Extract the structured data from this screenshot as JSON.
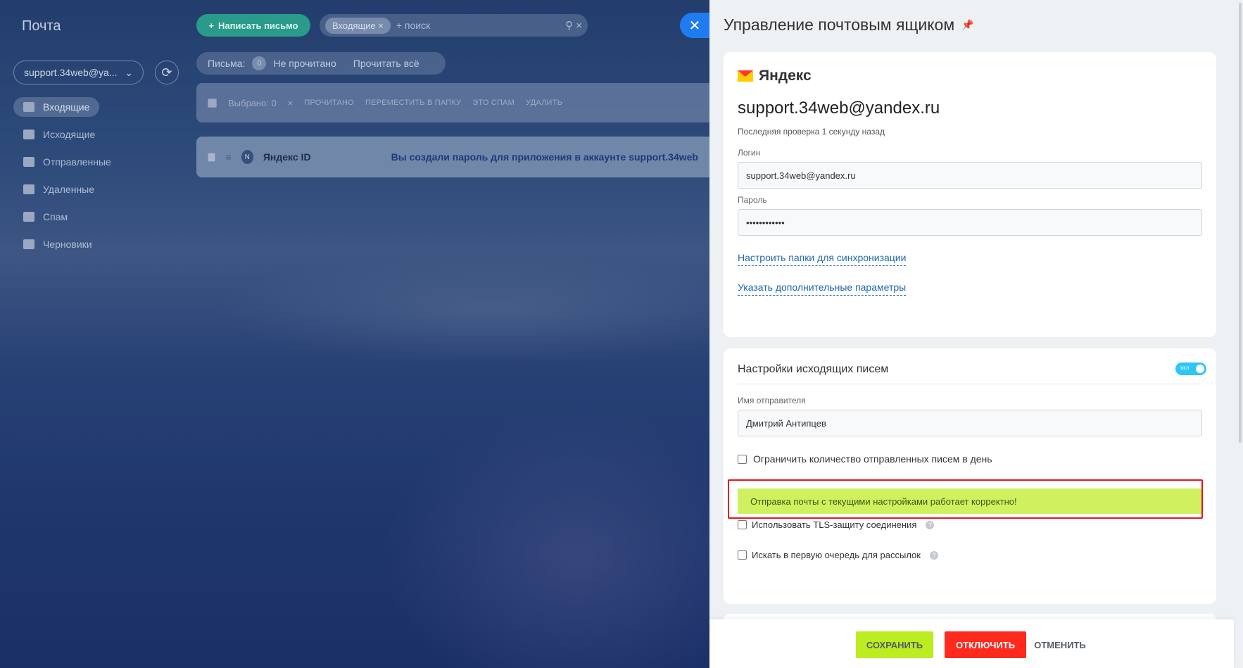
{
  "left": {
    "app_title": "Почта",
    "account": "support.34web@ya...",
    "nav": [
      "Входящие",
      "Исходящие",
      "Отправленные",
      "Удаленные",
      "Спам",
      "Черновики"
    ],
    "compose": "Написать письмо",
    "search_chip": "Входящие",
    "search_placeholder": "+ поиск",
    "filter_label": "Письма:",
    "filter_count": "0",
    "filter_unread": "Не прочитано",
    "filter_read_all": "Прочитать всё",
    "selected": "Выбрано: 0",
    "actions": [
      "ПРОЧИТАНО",
      "ПЕРЕМЕСТИТЬ В ПАПКУ",
      "ЭТО СПАМ",
      "УДАЛИТЬ"
    ],
    "mail": {
      "avatar": "N",
      "sender": "Яндекс ID",
      "subject": "Вы создали пароль для приложения в аккаунте support.34web"
    }
  },
  "panel": {
    "title": "Управление почтовым ящиком",
    "provider": "Яндекс",
    "email": "support.34web@yandex.ru",
    "last_check": "Последняя проверка 1 секунду назад",
    "login_label": "Логин",
    "login_value": "support.34web@yandex.ru",
    "password_label": "Пароль",
    "password_value": "••••••••••••",
    "link_folders": "Настроить папки для синхронизации",
    "link_params": "Указать дополнительные параметры",
    "outgoing_title": "Настройки исходящих писем",
    "toggle_text": "вкл",
    "sender_label": "Имя отправителя",
    "sender_value": "Дмитрий Антипцев",
    "limit_label": "Ограничить количество отправленных писем в день",
    "success": "Отправка почты с текущими настройками работает корректно!",
    "tls_label": "Использовать TLS-защиту соединения",
    "priority_label": "Искать в первую очередь для рассылок",
    "help": "?"
  },
  "footer": {
    "save": "СОХРАНИТЬ",
    "disable": "ОТКЛЮЧИТЬ",
    "cancel": "ОТМЕНИТЬ"
  },
  "colors": {
    "accent_blue": "#1f7cf0",
    "save_green": "#bbed21",
    "danger_red": "#ff2a1e",
    "success_bg": "#d1f060",
    "toggle_on": "#2fc6f6",
    "highlight_frame": "#e8161d"
  }
}
